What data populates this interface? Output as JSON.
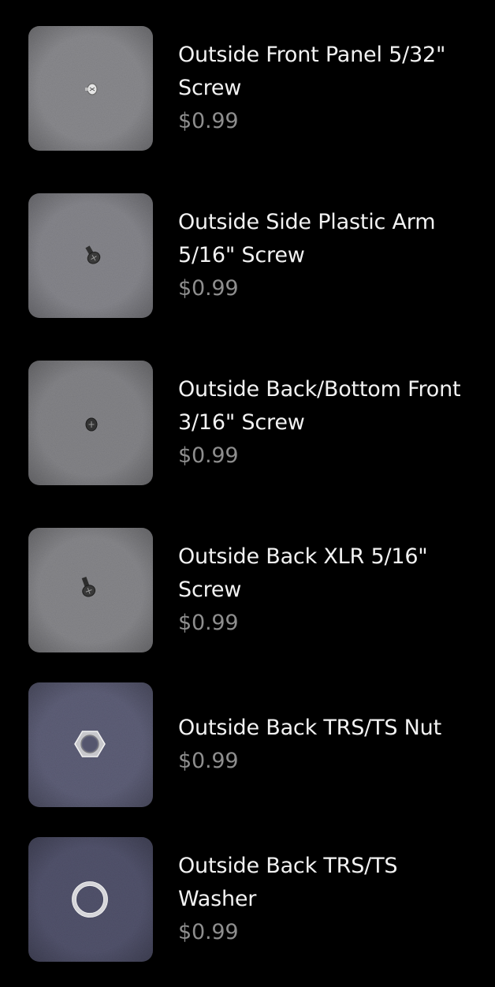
{
  "colors": {
    "background": "#000000",
    "title_text": "#f2f2f2",
    "price_text": "#8e8e8e"
  },
  "products": [
    {
      "title": "Outside Front Panel 5/32\" Screw",
      "price": "$0.99",
      "image_icon": "small-screw-image",
      "photo_tone": "#8a8a8e"
    },
    {
      "title": "Outside Side Plastic Arm 5/16\" Screw",
      "price": "$0.99",
      "image_icon": "screw-image",
      "photo_tone": "#86868c"
    },
    {
      "title": "Outside Back/Bottom Front 3/16\" Screw",
      "price": "$0.99",
      "image_icon": "screw-head-image",
      "photo_tone": "#848488"
    },
    {
      "title": "Outside Back XLR 5/16\" Screw",
      "price": "$0.99",
      "image_icon": "screw-image",
      "photo_tone": "#87878b"
    },
    {
      "title": "Outside Back TRS/TS Nut",
      "price": "$0.99",
      "image_icon": "hex-nut-image",
      "photo_tone": "#5e5f78"
    },
    {
      "title": "Outside Back TRS/TS Washer",
      "price": "$0.99",
      "image_icon": "washer-image",
      "photo_tone": "#52536c"
    }
  ]
}
